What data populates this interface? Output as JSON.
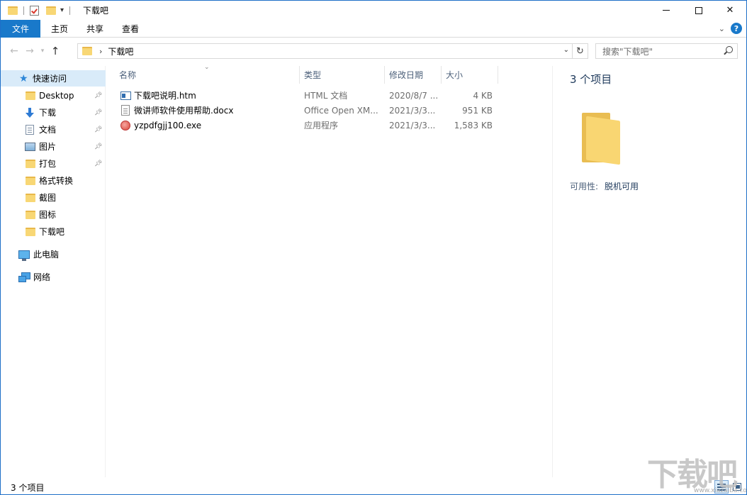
{
  "window": {
    "title": "下载吧",
    "controls": {
      "minimize": "minimize",
      "maximize": "maximize",
      "close": "✕"
    }
  },
  "ribbon": {
    "tabs": [
      {
        "label": "文件",
        "active": true
      },
      {
        "label": "主页"
      },
      {
        "label": "共享"
      },
      {
        "label": "查看"
      }
    ],
    "help": "?"
  },
  "address": {
    "path": "下载吧",
    "search_placeholder": "搜索\"下载吧\""
  },
  "navpane": {
    "quick_access": "快速访问",
    "items": [
      {
        "label": "Desktop",
        "icon": "folder-icon",
        "pinned": true
      },
      {
        "label": "下载",
        "icon": "download-icon",
        "pinned": true
      },
      {
        "label": "文档",
        "icon": "document-icon",
        "pinned": true
      },
      {
        "label": "图片",
        "icon": "picture-icon",
        "pinned": true
      },
      {
        "label": "打包",
        "icon": "folder-icon",
        "pinned": true
      },
      {
        "label": "格式转换",
        "icon": "folder-icon",
        "pinned": false
      },
      {
        "label": "截图",
        "icon": "folder-icon",
        "pinned": false
      },
      {
        "label": "图标",
        "icon": "folder-icon",
        "pinned": false
      },
      {
        "label": "下载吧",
        "icon": "folder-icon",
        "pinned": false
      }
    ],
    "this_pc": "此电脑",
    "network": "网络"
  },
  "filelist": {
    "columns": {
      "name": "名称",
      "type": "类型",
      "date": "修改日期",
      "size": "大小"
    },
    "files": [
      {
        "name": "下载吧说明.htm",
        "type": "HTML 文档",
        "date": "2020/8/7 ...",
        "size": "4 KB",
        "icon": "htm-file-icon"
      },
      {
        "name": "微讲师软件使用帮助.docx",
        "type": "Office Open XM...",
        "date": "2021/3/3...",
        "size": "951 KB",
        "icon": "docx-file-icon"
      },
      {
        "name": "yzpdfgjj100.exe",
        "type": "应用程序",
        "date": "2021/3/3...",
        "size": "1,583 KB",
        "icon": "exe-file-icon"
      }
    ]
  },
  "details": {
    "title": "3 个项目",
    "availability_label": "可用性:",
    "availability_value": "脱机可用"
  },
  "status": {
    "text": "3 个项目"
  },
  "watermark": {
    "text": "下载吧",
    "url": "www.xiazaiba.com"
  },
  "colors": {
    "accent": "#1979ca",
    "selection": "#d9ebf9",
    "folder": "#f8d775"
  }
}
